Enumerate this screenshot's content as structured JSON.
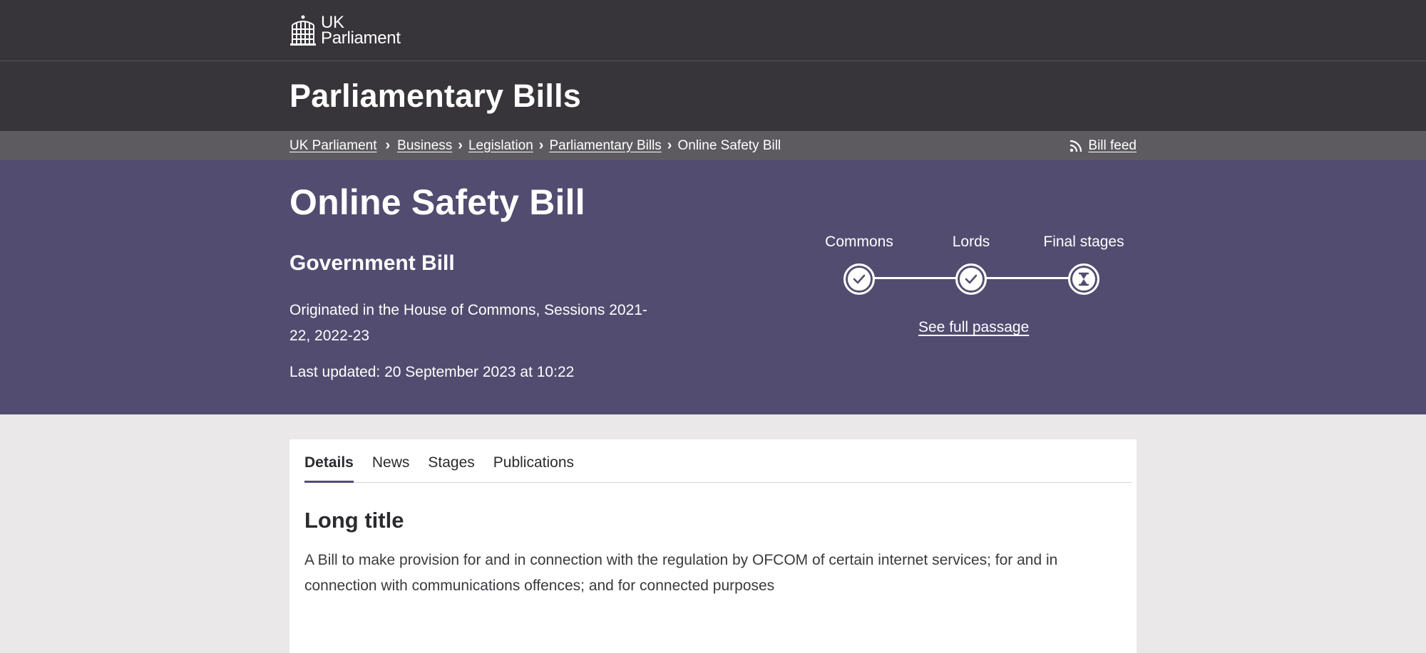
{
  "masthead": {
    "logo_line1": "UK",
    "logo_line2": "Parliament"
  },
  "service": {
    "title": "Parliamentary Bills"
  },
  "breadcrumb": {
    "items": [
      "UK Parliament",
      "Business",
      "Legislation",
      "Parliamentary Bills"
    ],
    "current": "Online Safety Bill",
    "feed_label": "Bill feed"
  },
  "bill": {
    "title": "Online Safety Bill",
    "type": "Government Bill",
    "origin": "Originated in the House of Commons, Sessions 2021-22, 2022-23",
    "last_updated": "Last updated: 20 September 2023 at 10:22"
  },
  "progress": {
    "stages": [
      {
        "label": "Commons",
        "status": "complete",
        "icon": "check-icon"
      },
      {
        "label": "Lords",
        "status": "complete",
        "icon": "check-icon"
      },
      {
        "label": "Final stages",
        "status": "in-progress",
        "icon": "hourglass-icon"
      }
    ],
    "link_label": "See full passage"
  },
  "tabs": [
    {
      "label": "Details",
      "active": true
    },
    {
      "label": "News",
      "active": false
    },
    {
      "label": "Stages",
      "active": false
    },
    {
      "label": "Publications",
      "active": false
    }
  ],
  "details": {
    "heading": "Long title",
    "text": "A Bill to make provision for and in connection with the regulation by OFCOM of certain internet services; for and in connection with communications offences; and for connected purposes"
  },
  "colors": {
    "masthead_bg": "#373539",
    "breadcrumb_bg": "#5d5b60",
    "hero_bg": "#524c70",
    "page_bg": "#eae8e9"
  }
}
